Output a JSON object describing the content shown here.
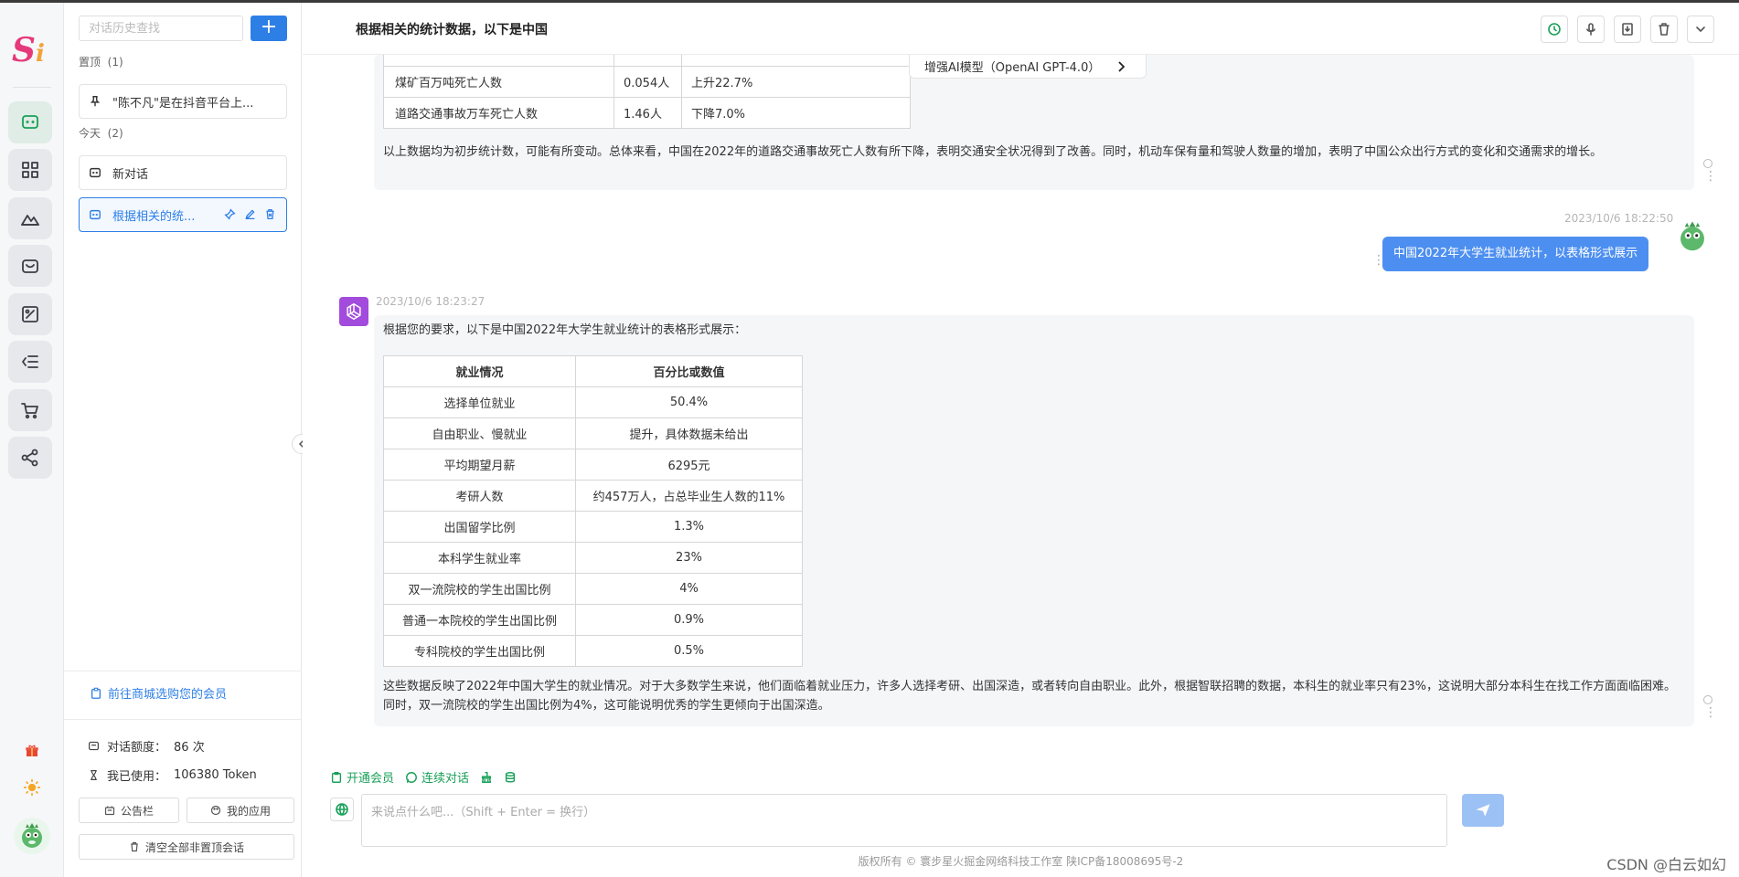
{
  "rail": {
    "logo_main": "S",
    "logo_accent": "i"
  },
  "sidebar": {
    "search_placeholder": "对话历史查找",
    "add_label": "+",
    "pinned_label": "置顶",
    "pinned_count": "(1)",
    "pinned_item": "\"陈不凡\"是在抖音平台上...",
    "today_label": "今天",
    "today_count": "(2)",
    "items": [
      {
        "label": "新对话"
      },
      {
        "label": "根据相关的统..."
      }
    ],
    "member_link": "前往商城选购您的会员",
    "quota_label": "对话额度：",
    "quota_value": "86 次",
    "used_label": "我已使用：",
    "used_value": "106380 Token",
    "notice_btn": "公告栏",
    "apps_btn": "我的应用",
    "clear_btn": "清空全部非置顶会话"
  },
  "header": {
    "title": "根据相关的统计数据，以下是中国"
  },
  "model_chip": "增强AI模型（OpenAI GPT-4.0）",
  "messages": {
    "first_table_rows": [
      [
        "煤矿百万吨死亡人数",
        "0.054人",
        "上升22.7%"
      ],
      [
        "道路交通事故万车死亡人数",
        "1.46人",
        "下降7.0%"
      ]
    ],
    "first_paragraph": "以上数据均为初步统计数，可能有所变动。总体来看，中国在2022年的道路交通事故死亡人数有所下降，表明交通安全状况得到了改善。同时，机动车保有量和驾驶人数量的增加，表明了中国公众出行方式的变化和交通需求的增长。",
    "user_time": "2023/10/6 18:22:50",
    "user_text": "中国2022年大学生就业统计，以表格形式展示",
    "ai_time": "2023/10/6 18:23:27",
    "ai_intro": "根据您的要求，以下是中国2022年大学生就业统计的表格形式展示：",
    "table_headers": [
      "就业情况",
      "百分比或数值"
    ],
    "table_rows": [
      [
        "选择单位就业",
        "50.4%"
      ],
      [
        "自由职业、慢就业",
        "提升，具体数据未给出"
      ],
      [
        "平均期望月薪",
        "6295元"
      ],
      [
        "考研人数",
        "约457万人，占总毕业生人数的11%"
      ],
      [
        "出国留学比例",
        "1.3%"
      ],
      [
        "本科学生就业率",
        "23%"
      ],
      [
        "双一流院校的学生出国比例",
        "4%"
      ],
      [
        "普通一本院校的学生出国比例",
        "0.9%"
      ],
      [
        "专科院校的学生出国比例",
        "0.5%"
      ]
    ],
    "ai_conclusion": "这些数据反映了2022年中国大学生的就业情况。对于大多数学生来说，他们面临着就业压力，许多人选择考研、出国深造，或者转向自由职业。此外，根据智联招聘的数据，本科生的就业率只有23%，这说明大部分本科生在找工作方面面临困难。同时，双一流院校的学生出国比例为4%，这可能说明优秀的学生更倾向于出国深造。"
  },
  "actions": {
    "open_member": "开通会员",
    "continuous": "连续对话"
  },
  "input": {
    "placeholder": "来说点什么吧...（Shift + Enter = 换行）"
  },
  "footer": "版权所有 © 寰步星火掘金网络科技工作室 陕ICP备18008695号-2",
  "watermark": "CSDN @白云如幻",
  "colors": {
    "accent_blue": "#2d7fe6",
    "accent_green": "#18a058",
    "user_bubble": "#4d8ff0"
  }
}
